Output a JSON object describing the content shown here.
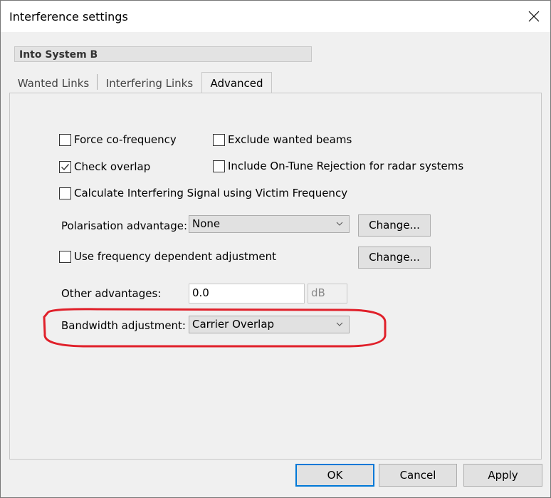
{
  "window": {
    "title": "Interference settings",
    "close_icon": "close-icon"
  },
  "system_label": "Into System B",
  "tabs": [
    {
      "label": "Wanted Links",
      "active": false
    },
    {
      "label": "Interfering Links",
      "active": false
    },
    {
      "label": "Advanced",
      "active": true
    }
  ],
  "advanced": {
    "checkboxes": {
      "force_cofrequency": {
        "label": "Force co-frequency",
        "checked": false
      },
      "exclude_wanted_beams": {
        "label": "Exclude wanted beams",
        "checked": false
      },
      "check_overlap": {
        "label": "Check overlap",
        "checked": true
      },
      "include_on_tune_rejection": {
        "label": "Include On-Tune Rejection for radar systems",
        "checked": false
      },
      "calculate_victim_frequency": {
        "label": "Calculate Interfering Signal using Victim Frequency",
        "checked": false
      },
      "use_freq_dependent": {
        "label": "Use frequency dependent adjustment",
        "checked": false
      }
    },
    "polarisation": {
      "label": "Polarisation advantage:",
      "selected": "None",
      "change_label": "Change..."
    },
    "freq_change_label": "Change...",
    "other_advantages": {
      "label": "Other advantages:",
      "value": "0.0",
      "unit": "dB"
    },
    "bandwidth": {
      "label": "Bandwidth adjustment:",
      "selected": "Carrier Overlap"
    },
    "annotation_color": "#e0202a"
  },
  "footer": {
    "ok_label": "OK",
    "cancel_label": "Cancel",
    "apply_label": "Apply"
  }
}
